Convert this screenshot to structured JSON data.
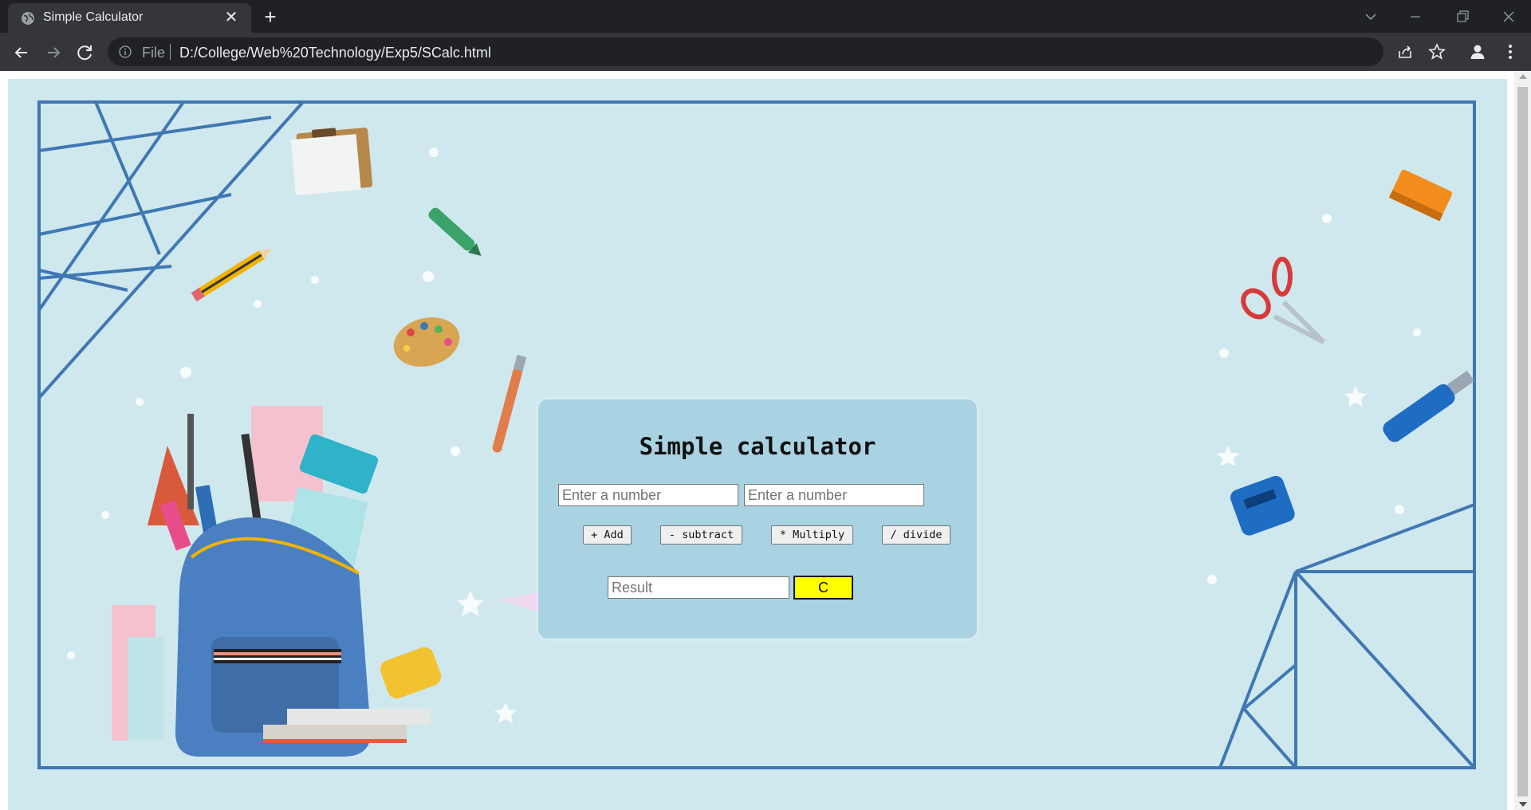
{
  "browser": {
    "tab_title": "Simple Calculator",
    "url_scheme": "File",
    "url": "D:/College/Web%20Technology/Exp5/SCalc.html",
    "icons": [
      "globe-icon",
      "close-icon",
      "plus-icon",
      "chevron-down-icon",
      "minimize-icon",
      "restore-icon",
      "window-close-icon",
      "back-arrow-icon",
      "forward-arrow-icon",
      "reload-icon",
      "info-icon",
      "share-icon",
      "star-icon",
      "profile-icon",
      "kebab-menu-icon"
    ]
  },
  "calculator": {
    "title": "Simple calculator",
    "input1_placeholder": "Enter a number",
    "input2_placeholder": "Enter a number",
    "buttons": {
      "add": "+ Add",
      "subtract": "- subtract",
      "multiply": "* Multiply",
      "divide": "/ divide",
      "clear": "C"
    },
    "result_placeholder": "Result"
  },
  "colors": {
    "background": "#cfe8ee",
    "card": "#a9d3e2",
    "frame": "#3f78b3",
    "clear_button": "#ffff00"
  }
}
